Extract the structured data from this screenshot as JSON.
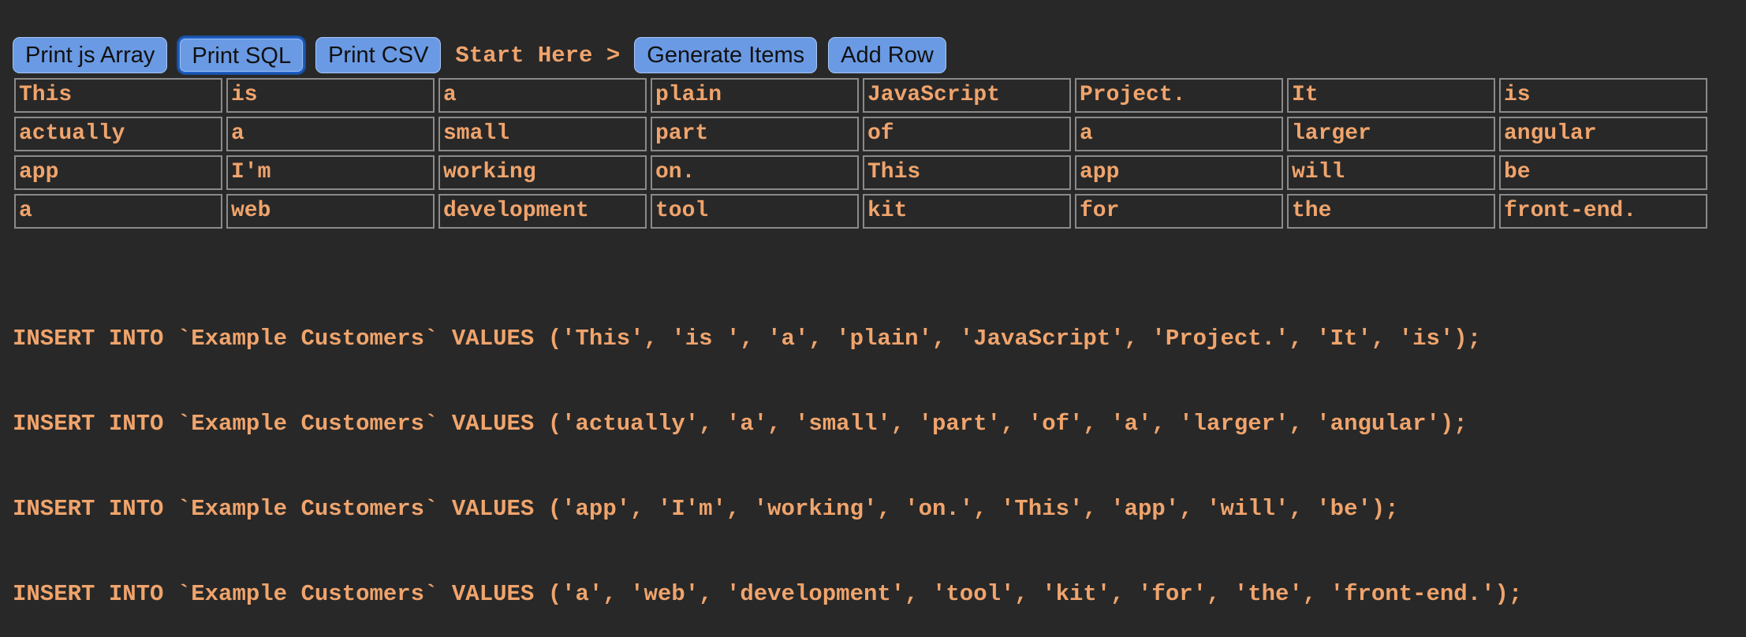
{
  "toolbar": {
    "buttons": [
      {
        "label": "Print js Array"
      },
      {
        "label": "Print SQL"
      },
      {
        "label": "Print CSV"
      },
      {
        "label": "Generate Items"
      },
      {
        "label": "Add Row"
      }
    ],
    "start_label": "Start Here >"
  },
  "grid": {
    "rows": [
      [
        "This",
        "is",
        "a",
        "plain",
        "JavaScript",
        "Project.",
        "It",
        "is"
      ],
      [
        "actually",
        "a",
        "small",
        "part",
        "of",
        "a",
        "larger",
        "angular"
      ],
      [
        "app",
        "I'm",
        "working",
        "on.",
        "This",
        "app",
        "will",
        "be"
      ],
      [
        "a",
        "web",
        "development",
        "tool",
        "kit",
        "for",
        "the",
        "front-end."
      ]
    ]
  },
  "output": {
    "lines": [
      "INSERT INTO `Example Customers` VALUES ('This', 'is ', 'a', 'plain', 'JavaScript', 'Project.', 'It', 'is');",
      "INSERT INTO `Example Customers` VALUES ('actually', 'a', 'small', 'part', 'of', 'a', 'larger', 'angular');",
      "INSERT INTO `Example Customers` VALUES ('app', 'I'm', 'working', 'on.', 'This', 'app', 'will', 'be');",
      "INSERT INTO `Example Customers` VALUES ('a', 'web', 'development', 'tool', 'kit', 'for', 'the', 'front-end.');"
    ]
  },
  "colors": {
    "background": "#282828",
    "text_accent": "#f0a46c",
    "button_fill": "#6a9ae4",
    "button_active_border": "#1f5fc6",
    "cell_border": "#8a8a8a"
  }
}
